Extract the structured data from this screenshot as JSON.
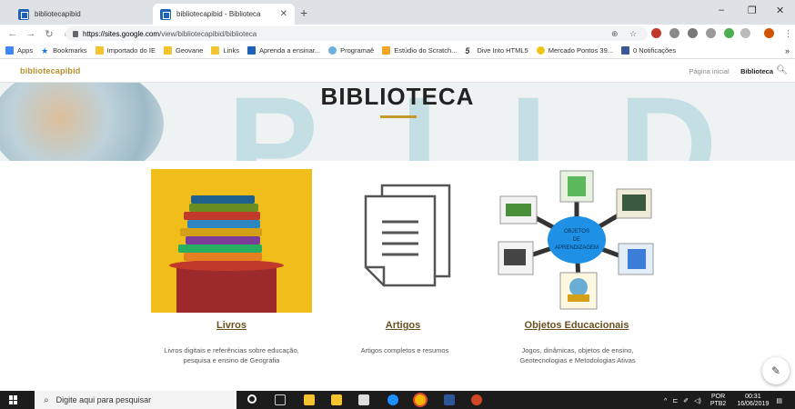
{
  "browser": {
    "tabs": [
      {
        "label": "bibliotecapibid",
        "active": false
      },
      {
        "label": "bibliotecapibid - Biblioteca",
        "active": true
      }
    ],
    "url_host": "https://sites.google.com",
    "url_path": "/view/bibliotecapibid/biblioteca",
    "bookmarks": [
      {
        "label": "Apps",
        "icon": "apps-grid-icon"
      },
      {
        "label": "Bookmarks",
        "icon": "star-icon"
      },
      {
        "label": "Importado do IE",
        "icon": "folder-icon"
      },
      {
        "label": "Geovane",
        "icon": "folder-icon"
      },
      {
        "label": "Links",
        "icon": "folder-icon"
      },
      {
        "label": "Aprenda a ensinar...",
        "icon": "gc-icon"
      },
      {
        "label": "Programaê",
        "icon": "programae-icon"
      },
      {
        "label": "Estúdio do Scratch...",
        "icon": "scratch-icon"
      },
      {
        "label": "Dive Into HTML5",
        "icon": "html5-icon"
      },
      {
        "label": "Mercado Pontos 39...",
        "icon": "mercado-icon"
      },
      {
        "label": "0 Notificações",
        "icon": "facebook-icon"
      }
    ]
  },
  "site": {
    "name": "bibliotecapibid",
    "nav": {
      "home": "Página inicial",
      "current": "Biblioteca"
    },
    "banner_title": "BIBLIOTECA"
  },
  "cards": [
    {
      "title": "Livros",
      "desc1": "Livros digitais e referências sobre educação,",
      "desc2": "pesquisa e ensino de Geografia",
      "icon": "books-image"
    },
    {
      "title": "Artigos",
      "desc1": "Artigos completos e resumos",
      "desc2": "",
      "icon": "documents-icon"
    },
    {
      "title": "Objetos Educacionais",
      "desc1": "Jogos, dinâmicas, objetos de ensino,",
      "desc2": "Geotecnologias e Metodologias Ativas",
      "icon": "learning-objects-diagram"
    }
  ],
  "objects_center": {
    "line1": "OBJETOS",
    "line2": "DE",
    "line3": "APRENDIZAGEM"
  },
  "taskbar": {
    "search_placeholder": "Digite aqui para pesquisar",
    "lang1": "POR",
    "lang2": "PTB2",
    "time": "00:31",
    "date": "16/06/2019"
  },
  "colors": {
    "accent_gold": "#c29b2c",
    "site_name": "#b58f2c",
    "card_title": "#6a5020",
    "books_bg": "#f1bd1a"
  }
}
